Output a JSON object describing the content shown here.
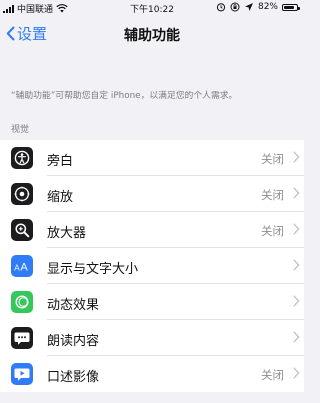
{
  "status_bar": {
    "carrier": "中国联通",
    "time": "下午10:22",
    "battery": "82%"
  },
  "nav": {
    "back_label": "设置",
    "title": "辅助功能"
  },
  "description": "“辅助功能”可帮助您自定 iPhone，以满足您的个人需求。",
  "section_header": "视觉",
  "rows": [
    {
      "label": "旁白",
      "value": "关闭",
      "icon": "voiceover-icon",
      "color": "#1c1c1e"
    },
    {
      "label": "缩放",
      "value": "关闭",
      "icon": "zoom-icon",
      "color": "#1c1c1e"
    },
    {
      "label": "放大器",
      "value": "关闭",
      "icon": "magnifier-icon",
      "color": "#1c1c1e"
    },
    {
      "label": "显示与文字大小",
      "value": "",
      "icon": "text-size-icon",
      "color": "#2f7cf6"
    },
    {
      "label": "动态效果",
      "value": "",
      "icon": "motion-icon",
      "color": "#34c759"
    },
    {
      "label": "朗读内容",
      "value": "",
      "icon": "spoken-content-icon",
      "color": "#1c1c1e"
    },
    {
      "label": "口述影像",
      "value": "关闭",
      "icon": "audio-description-icon",
      "color": "#2f7cf6"
    }
  ]
}
